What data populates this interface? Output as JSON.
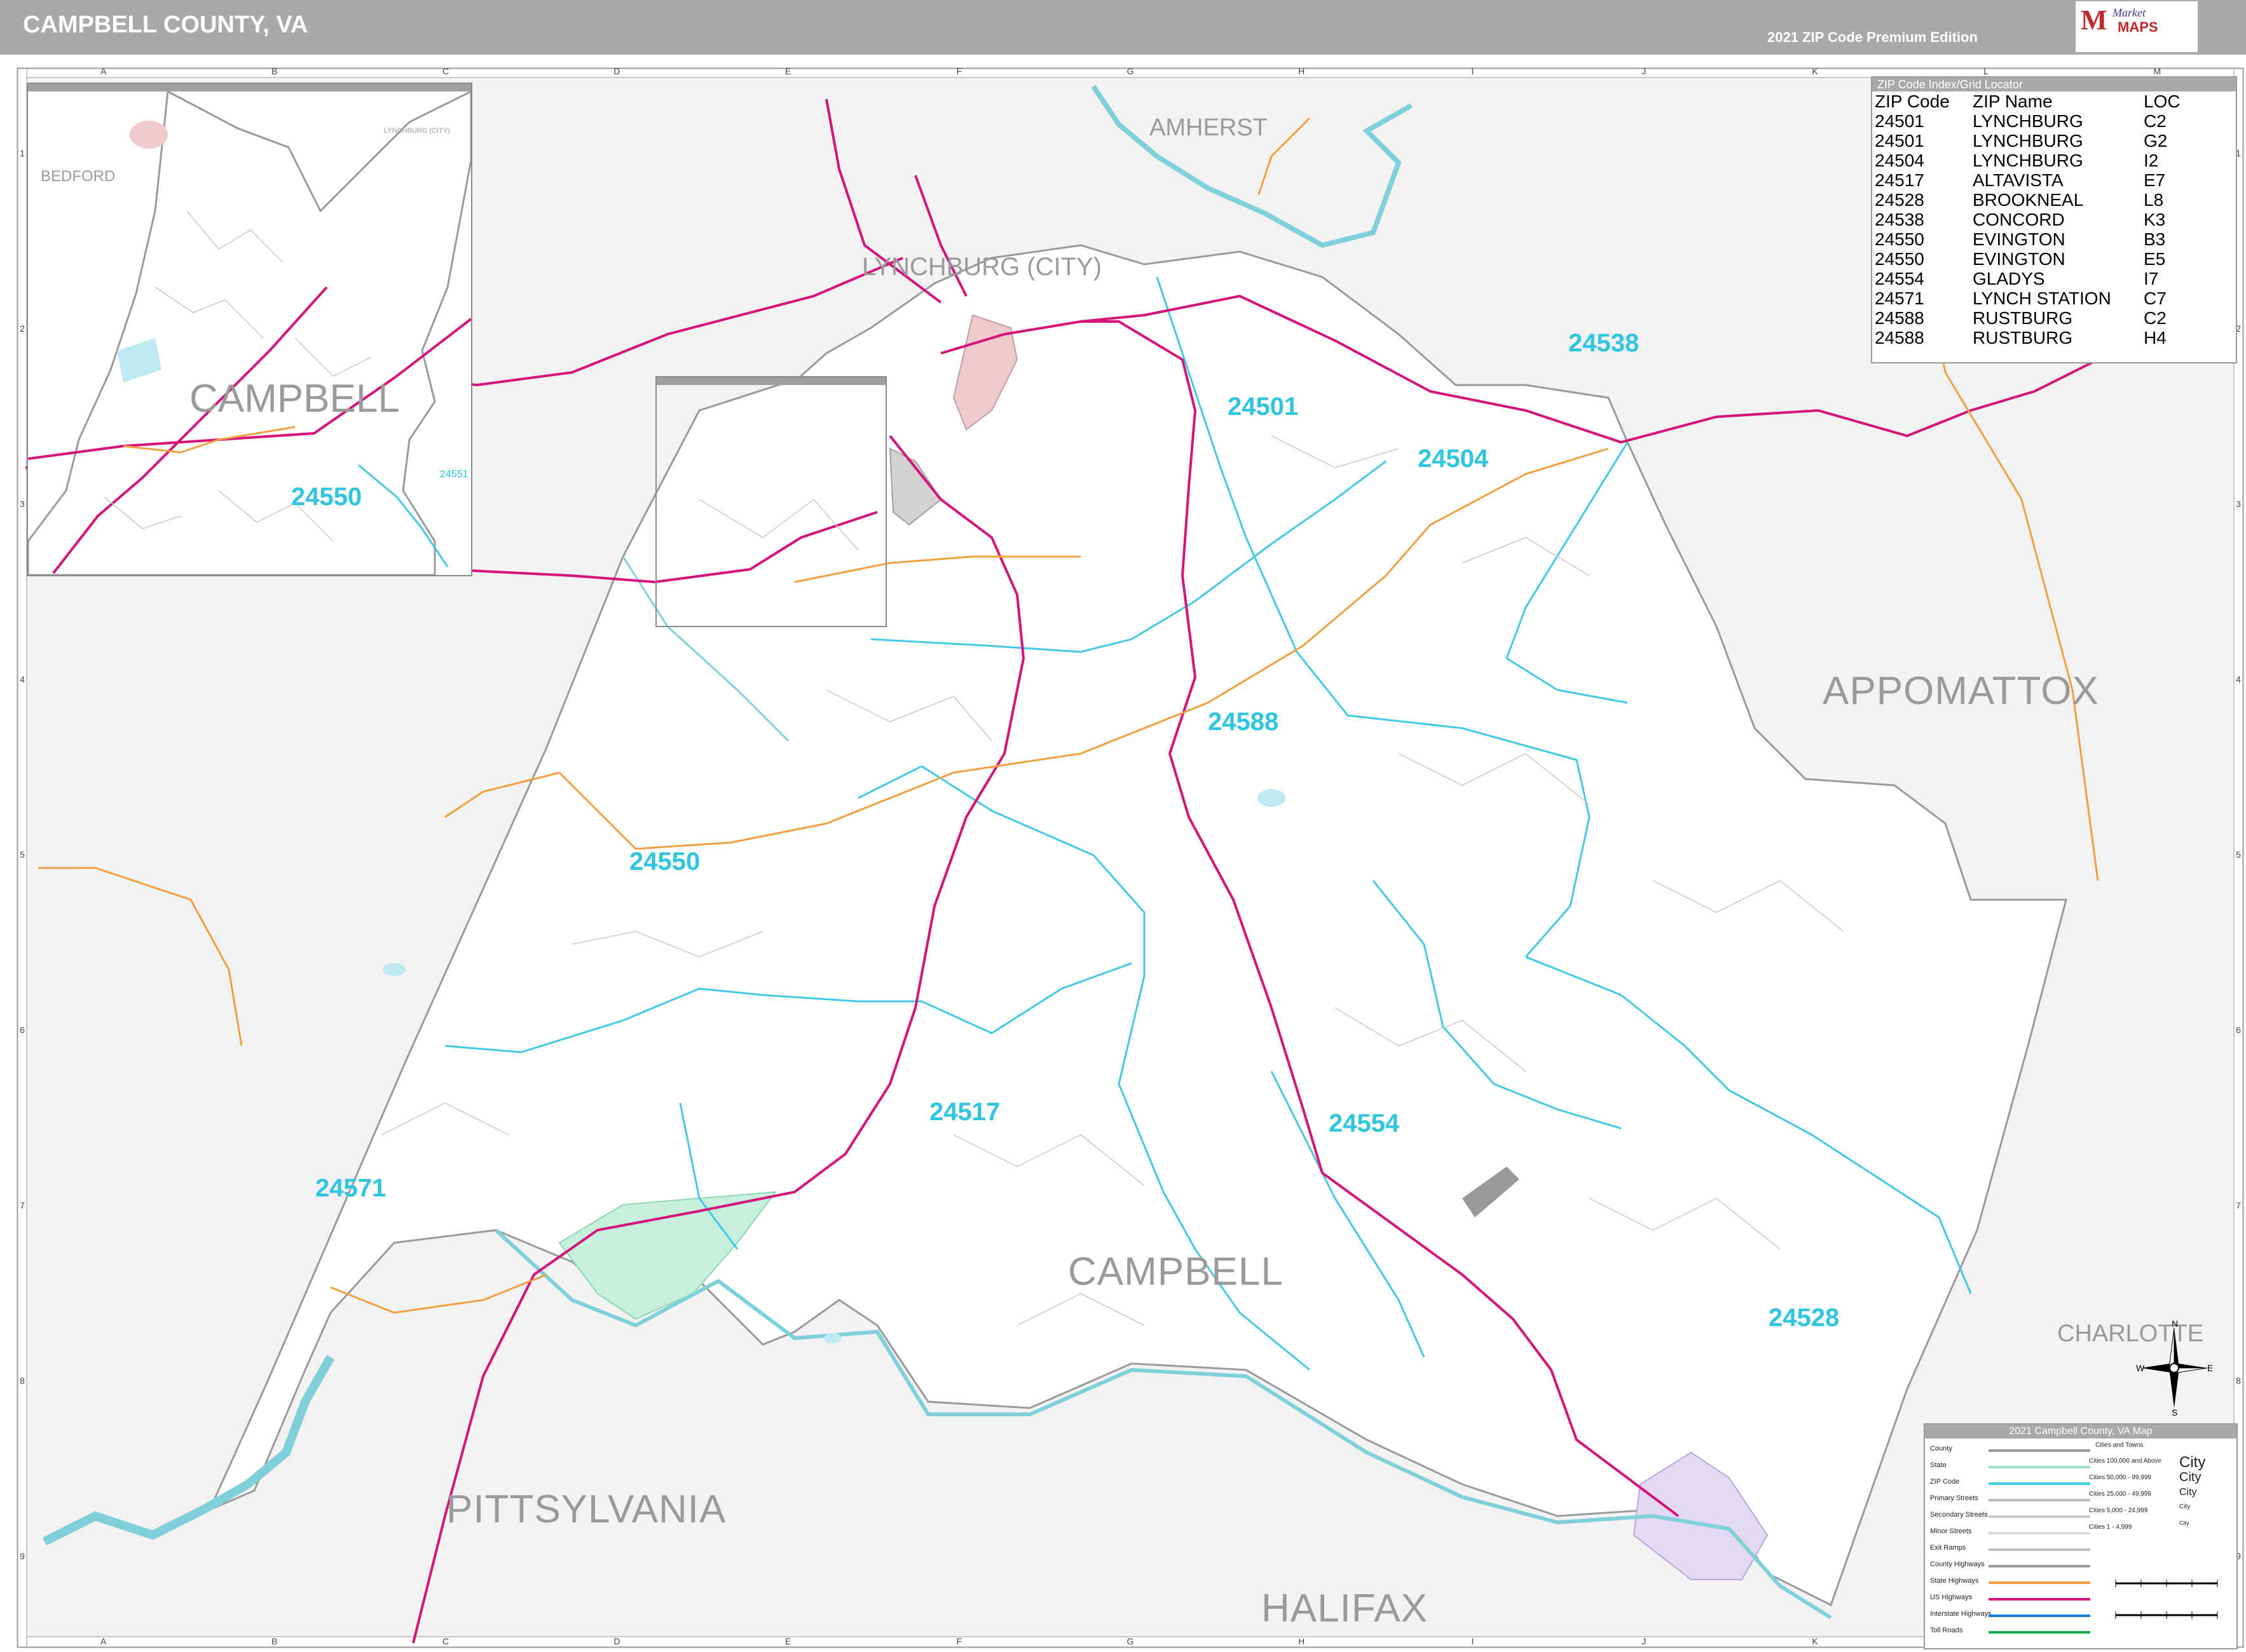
{
  "header": {
    "title": "CAMPBELL COUNTY, VA",
    "edition": "2021 ZIP Code Premium Edition",
    "logo_word": "Market",
    "logo_maps": "MAPS",
    "logo_letter": "M"
  },
  "grid": {
    "columns": [
      "A",
      "B",
      "C",
      "D",
      "E",
      "F",
      "G",
      "H",
      "I",
      "J",
      "K",
      "L",
      "M"
    ],
    "rows": [
      "1",
      "2",
      "3",
      "4",
      "5",
      "6",
      "7",
      "8",
      "9"
    ]
  },
  "map": {
    "counties": [
      {
        "name": "AMHERST"
      },
      {
        "name": "APPOMATTOX"
      },
      {
        "name": "CAMPBELL"
      },
      {
        "name": "PITTSYLVANIA"
      },
      {
        "name": "HALIFAX"
      },
      {
        "name": "CHARLOTTE"
      },
      {
        "name": "BEDFORD"
      }
    ],
    "cities": [
      {
        "name": "LYNCHBURG (CITY)"
      }
    ],
    "zip_labels": [
      "24538",
      "24501",
      "24504",
      "24588",
      "24550",
      "24517",
      "24554",
      "24571",
      "24528"
    ]
  },
  "inset_a": {
    "county_label": "CAMPBELL",
    "outside_label": "BEDFORD",
    "city_label": "LYNCHBURG (CITY)",
    "zip_large": "24550",
    "zip_small": "24551"
  },
  "zip_index": {
    "title": "ZIP Code Index/Grid Locator",
    "columns": [
      "ZIP Code",
      "ZIP Name",
      "LOC"
    ],
    "rows": [
      [
        "24501",
        "LYNCHBURG",
        "C2"
      ],
      [
        "24501",
        "LYNCHBURG",
        "G2"
      ],
      [
        "24504",
        "LYNCHBURG",
        "I2"
      ],
      [
        "24517",
        "ALTAVISTA",
        "E7"
      ],
      [
        "24528",
        "BROOKNEAL",
        "L8"
      ],
      [
        "24538",
        "CONCORD",
        "K3"
      ],
      [
        "24550",
        "EVINGTON",
        "B3"
      ],
      [
        "24550",
        "EVINGTON",
        "E5"
      ],
      [
        "24554",
        "GLADYS",
        "I7"
      ],
      [
        "24571",
        "LYNCH STATION",
        "C7"
      ],
      [
        "24588",
        "RUSTBURG",
        "C2"
      ],
      [
        "24588",
        "RUSTBURG",
        "H4"
      ]
    ]
  },
  "legend": {
    "title": "2021 Campbell County, VA Map",
    "items": [
      {
        "label": "County",
        "color": "#9a9a9a"
      },
      {
        "label": "State",
        "color": "#9be3c4"
      },
      {
        "label": "ZIP Code",
        "color": "#43c8e6"
      },
      {
        "label": "Primary Streets",
        "color": "#b9b9b9"
      },
      {
        "label": "Secondary Streets",
        "color": "#c8c8c8"
      },
      {
        "label": "Minor Streets",
        "color": "#dcdcdc"
      },
      {
        "label": "Exit Ramps",
        "color": "#bdbdbd"
      },
      {
        "label": "County Highways",
        "color": "#9a9a9a"
      },
      {
        "label": "State Highways",
        "color": "#f0a040"
      },
      {
        "label": "US Highways",
        "color": "#d4147a"
      },
      {
        "label": "Interstate Highways",
        "color": "#1a7bd1"
      },
      {
        "label": "Toll Roads",
        "color": "#18a84a"
      }
    ],
    "cities_towns_title": "Cities and Towns",
    "city_classes": [
      {
        "label": "Cities 100,000 and Above",
        "sample": "City"
      },
      {
        "label": "Cities 50,000 - 99,999",
        "sample": "City"
      },
      {
        "label": "Cities 25,000 - 49,999",
        "sample": "City"
      },
      {
        "label": "Cities 5,000 - 24,999",
        "sample": "City"
      },
      {
        "label": "Cities 1 - 4,999",
        "sample": "City"
      }
    ]
  },
  "compass": {
    "n": "N",
    "s": "S",
    "e": "E",
    "w": "W"
  }
}
